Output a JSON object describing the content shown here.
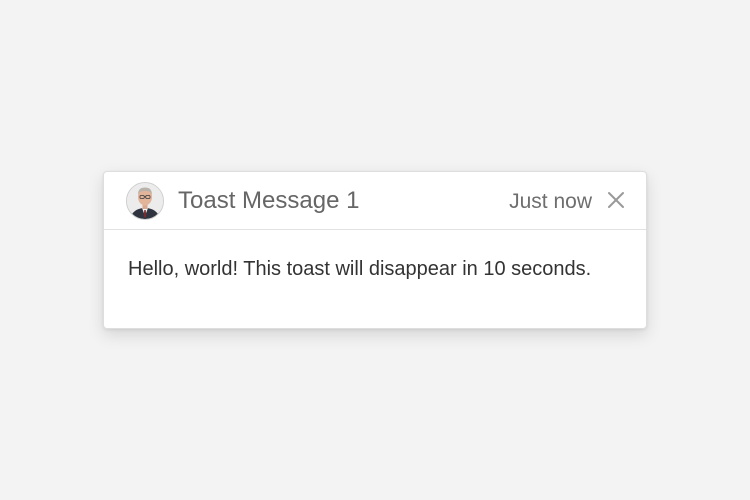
{
  "toast": {
    "title": "Toast Message 1",
    "timestamp": "Just now",
    "message": "Hello, world! This toast will disappear in 10 seconds.",
    "avatar_icon": "user-avatar",
    "close_icon": "close-icon"
  },
  "colors": {
    "background": "#f3f3f3",
    "toast_background": "#ffffff",
    "title_text": "#666666",
    "body_text": "#333333",
    "close_icon": "#9a9a9a"
  }
}
